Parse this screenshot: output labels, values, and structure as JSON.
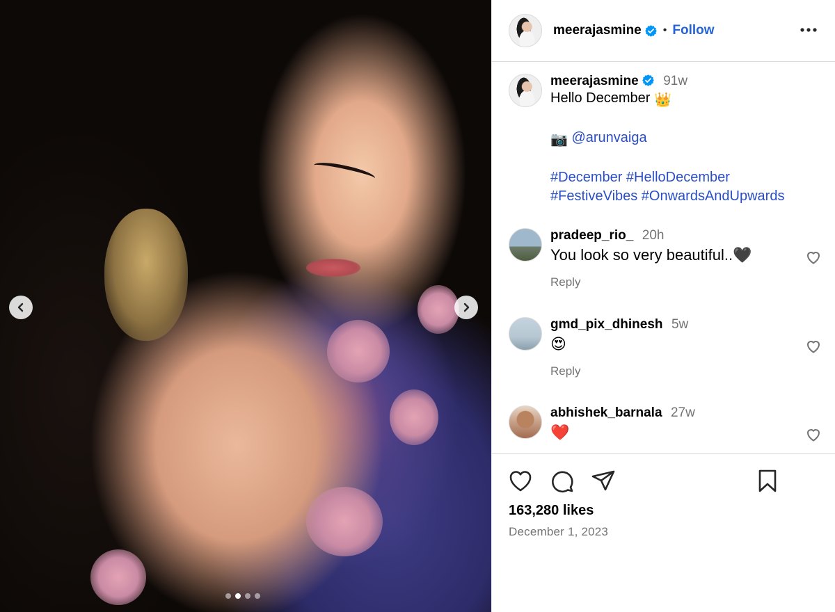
{
  "post": {
    "username": "meerajasmine",
    "follow_label": "Follow",
    "separator": "•",
    "caption": {
      "username": "meerajasmine",
      "time": "91w",
      "line1": "Hello December",
      "line1_emoji": "👑",
      "camera_emoji": "📷",
      "mention": "@arunvaiga",
      "hashtags_line1": "#December #HelloDecember",
      "hashtags_line2": "#FestiveVibes #OnwardsAndUpwards"
    },
    "comments": [
      {
        "username": "pradeep_rio_",
        "time": "20h",
        "text": "You look so very beautiful..",
        "emoji": "🖤",
        "reply_label": "Reply"
      },
      {
        "username": "gmd_pix_dhinesh",
        "time": "5w",
        "text": "",
        "emoji": "😍",
        "reply_label": "Reply"
      },
      {
        "username": "abhishek_barnala",
        "time": "27w",
        "text": "",
        "emoji": "❤️",
        "reply_label": ""
      }
    ],
    "likes": "163,280 likes",
    "date": "December 1, 2023"
  },
  "carousel": {
    "slide_count": 4,
    "active_index": 1
  },
  "icons": {
    "prev": "chevron-left-icon",
    "next": "chevron-right-icon",
    "more": "more-horizontal-icon",
    "verified": "verified-badge-icon",
    "like": "heart-icon",
    "comment": "comment-icon",
    "share": "send-icon",
    "save": "bookmark-icon"
  },
  "colors": {
    "verified": "#0095f6",
    "link": "#2a4fc4",
    "follow": "#2563d4",
    "muted": "#737373"
  }
}
